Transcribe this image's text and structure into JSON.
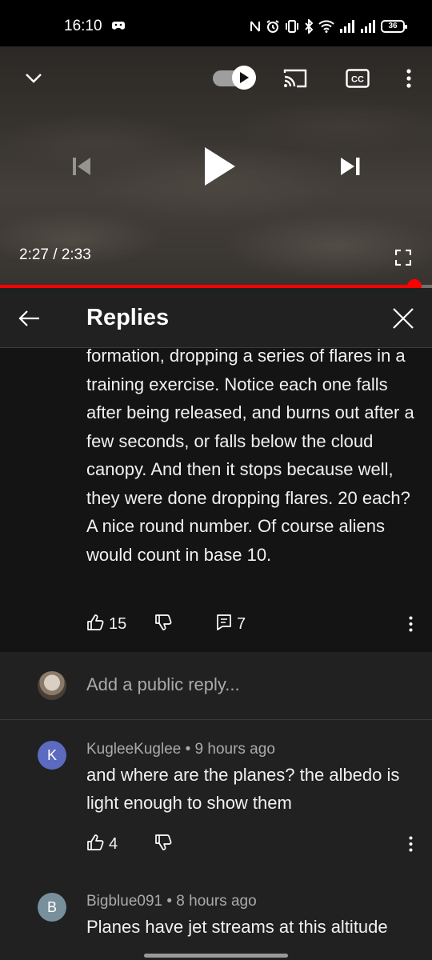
{
  "status_bar": {
    "time": "16:10",
    "battery": "36"
  },
  "player": {
    "time_readout": "2:27 / 2:33",
    "progress_fraction": 0.96,
    "autoplay_on": true,
    "icons": [
      "chevron-down-icon",
      "autoplay-toggle",
      "cast-icon",
      "cc-icon",
      "more-vert-icon",
      "skip-previous-icon",
      "play-icon",
      "skip-next-icon",
      "fullscreen-icon"
    ]
  },
  "replies_header": {
    "title": "Replies"
  },
  "parent_comment": {
    "text": "formation, dropping a series of flares in a training exercise. Notice each one falls after being released, and burns out after a few seconds, or falls below the cloud canopy. And then it stops because well, they were done dropping flares. 20 each? A nice round number. Of course aliens would count in base 10.",
    "likes": "15",
    "replies": "7"
  },
  "reply_box": {
    "placeholder": "Add a public reply..."
  },
  "comments": [
    {
      "avatar_letter": "K",
      "avatar_color": "#5c6bc0",
      "author": "KugleeKuglee",
      "age": "9 hours ago",
      "meta": "KugleeKuglee • 9 hours ago",
      "text": "and where are the planes? the albedo is light enough to show them",
      "likes": "4"
    },
    {
      "avatar_letter": "B",
      "avatar_color": "#78909c",
      "author": "Bigblue091",
      "age": "8 hours ago",
      "meta": "Bigblue091 • 8 hours ago",
      "text": "Planes have jet streams at this altitude"
    }
  ],
  "colors": {
    "accent_red": "#ff0000",
    "background": "#212121",
    "parent_background": "#141414"
  }
}
